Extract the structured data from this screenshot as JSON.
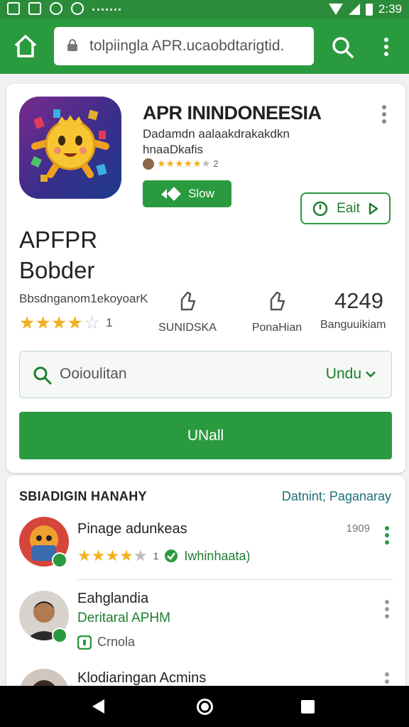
{
  "status_bar": {
    "time": "2:39"
  },
  "url_bar": {
    "url": "tolpiingla APR.ucaobdtarigtid."
  },
  "app": {
    "name": "APR ININDONEESIA",
    "developer": "Dadamdn aalaakdrakakdkn hnaaDkafis",
    "rating_count": "2",
    "show_label": "Slow",
    "edit_label": "Eait",
    "big_title_line1": "APFPR",
    "big_title_line2": "Bobder",
    "dev_line": "Bbsdnganom1ekoyoarK",
    "stars_count": "1",
    "stat1_label": "SUNIDSKA",
    "stat2_label": "PonaHian",
    "stat3_value": "4249",
    "stat3_label": "Banguuikiam",
    "search_placeholder": "Ooioulitan",
    "search_dropdown": "Undu",
    "install_label": "UNall",
    "accent_color": "#2a9a3e",
    "star_color": "#f2b01e"
  },
  "section": {
    "title": "SBIADIGIN HANAHY",
    "link": "Datnint; Paganaray",
    "rows": [
      {
        "name": "Pinage adunkeas",
        "meta": "Iwhinhaata)",
        "stars_count": "1",
        "time": "1909"
      },
      {
        "name": "Eahglandia",
        "sub": "Deritaral APHM",
        "meta": "Crnola"
      },
      {
        "name": "Klodiaringan Acmins"
      }
    ]
  }
}
